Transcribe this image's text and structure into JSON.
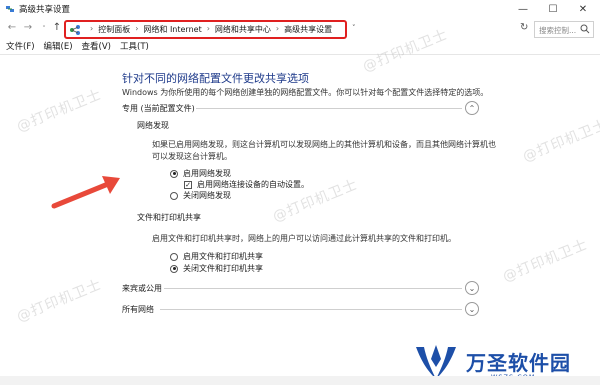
{
  "window": {
    "title": "高级共享设置",
    "minimize_glyph": "—",
    "maximize_glyph": "☐",
    "close_glyph": "✕"
  },
  "nav": {
    "back_glyph": "←",
    "forward_glyph": "→",
    "recent_glyph": "˅",
    "up_glyph": "↑"
  },
  "address": {
    "crumbs": [
      "控制面板",
      "网络和 Internet",
      "网络和共享中心",
      "高级共享设置"
    ],
    "separator": "›",
    "dropdown_glyph": "˅",
    "refresh_glyph": "↻",
    "highlight_color": "#e02020"
  },
  "search": {
    "placeholder": "搜索控制..."
  },
  "menu": [
    "文件(F)",
    "编辑(E)",
    "查看(V)",
    "工具(T)"
  ],
  "page": {
    "heading": "针对不同的网络配置文件更改共享选项",
    "description": "Windows 为你所使用的每个网络创建单独的网络配置文件。你可以针对每个配置文件选择特定的选项。"
  },
  "profiles": {
    "private": {
      "label": "专用 (当前配置文件)",
      "chevron": "⌃",
      "network_discovery": {
        "label": "网络发现",
        "text_line1": "如果已启用网络发现，则这台计算机可以发现网络上的其他计算机和设备，而且其他网络计算机也",
        "text_line2": "可以发现这台计算机。",
        "option_on": "启用网络发现",
        "option_auto": "启用网络连接设备的自动设置。",
        "option_off": "关闭网络发现",
        "selected": "on",
        "auto_checked": true
      },
      "file_printer_sharing": {
        "label": "文件和打印机共享",
        "text": "启用文件和打印机共享时，网络上的用户可以访问通过此计算机共享的文件和打印机。",
        "option_on": "启用文件和打印机共享",
        "option_off": "关闭文件和打印机共享",
        "selected": "off"
      }
    },
    "guest": {
      "label": "来宾或公用",
      "chevron": "⌄"
    },
    "all": {
      "label": "所有网络",
      "chevron": "⌄"
    }
  },
  "watermark": {
    "text": "@打印机卫士"
  },
  "logo": {
    "text": "万圣软件园",
    "sub": "WSZS.COM",
    "color": "#1d4fa8"
  },
  "colors": {
    "heading": "#1e3a8a",
    "arrow": "#e8493a"
  }
}
